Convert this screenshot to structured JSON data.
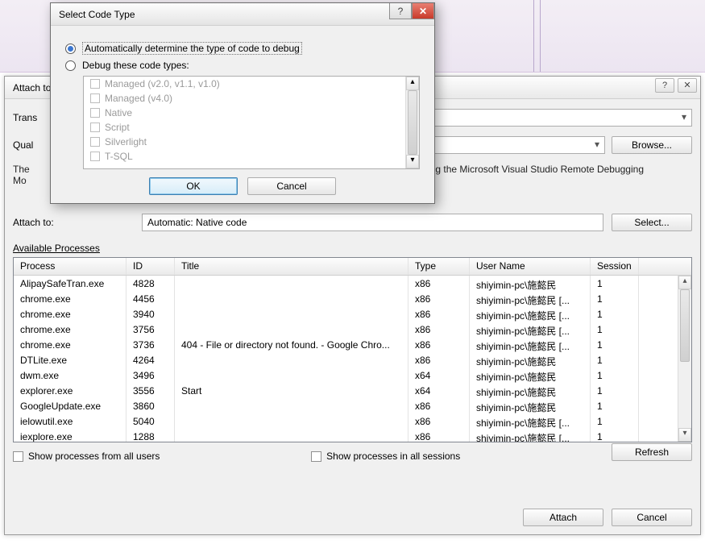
{
  "parent": {
    "title_prefix": "Attach to",
    "help_glyph": "?",
    "close_glyph": "✕",
    "labels": {
      "transport": "Trans",
      "qualifier": "Qual",
      "browse": "Browse...",
      "transport_desc_1": "The",
      "transport_desc_2": "Mo",
      "remote_tail": "g the Microsoft Visual Studio Remote Debugging",
      "attach_to": "Attach to:",
      "attach_to_value": "Automatic: Native code",
      "select": "Select...",
      "available": "Available Processes",
      "show_all_users": "Show processes from all users",
      "show_all_sessions": "Show processes in all sessions",
      "refresh": "Refresh",
      "attach": "Attach",
      "cancel": "Cancel"
    },
    "columns": {
      "process": "Process",
      "id": "ID",
      "title": "Title",
      "type": "Type",
      "user": "User Name",
      "session": "Session"
    },
    "processes": [
      {
        "proc": "AlipaySafeTran.exe",
        "id": "4828",
        "title": "",
        "type": "x86",
        "user": "shiyimin-pc\\施懿民",
        "sess": "1"
      },
      {
        "proc": "chrome.exe",
        "id": "4456",
        "title": "",
        "type": "x86",
        "user": "shiyimin-pc\\施懿民 [...",
        "sess": "1"
      },
      {
        "proc": "chrome.exe",
        "id": "3940",
        "title": "",
        "type": "x86",
        "user": "shiyimin-pc\\施懿民 [...",
        "sess": "1"
      },
      {
        "proc": "chrome.exe",
        "id": "3756",
        "title": "",
        "type": "x86",
        "user": "shiyimin-pc\\施懿民 [...",
        "sess": "1"
      },
      {
        "proc": "chrome.exe",
        "id": "3736",
        "title": "404 - File or directory not found. - Google Chro...",
        "type": "x86",
        "user": "shiyimin-pc\\施懿民 [...",
        "sess": "1"
      },
      {
        "proc": "DTLite.exe",
        "id": "4264",
        "title": "",
        "type": "x86",
        "user": "shiyimin-pc\\施懿民",
        "sess": "1"
      },
      {
        "proc": "dwm.exe",
        "id": "3496",
        "title": "",
        "type": "x64",
        "user": "shiyimin-pc\\施懿民",
        "sess": "1"
      },
      {
        "proc": "explorer.exe",
        "id": "3556",
        "title": "Start",
        "type": "x64",
        "user": "shiyimin-pc\\施懿民",
        "sess": "1"
      },
      {
        "proc": "GoogleUpdate.exe",
        "id": "3860",
        "title": "",
        "type": "x86",
        "user": "shiyimin-pc\\施懿民",
        "sess": "1"
      },
      {
        "proc": "ielowutil.exe",
        "id": "5040",
        "title": "",
        "type": "x86",
        "user": "shiyimin-pc\\施懿民 [...",
        "sess": "1"
      },
      {
        "proc": "iexplore.exe",
        "id": "1288",
        "title": "",
        "type": "x86",
        "user": "shiyimin-pc\\施懿民 [...",
        "sess": "1"
      }
    ]
  },
  "modal": {
    "title": "Select Code Type",
    "help_glyph": "?",
    "close_glyph": "✕",
    "radio_auto": "Automatically determine the type of code to debug",
    "radio_manual": "Debug these code types:",
    "types": [
      "Managed (v2.0, v1.1, v1.0)",
      "Managed (v4.0)",
      "Native",
      "Script",
      "Silverlight",
      "T-SQL"
    ],
    "ok": "OK",
    "cancel": "Cancel"
  }
}
